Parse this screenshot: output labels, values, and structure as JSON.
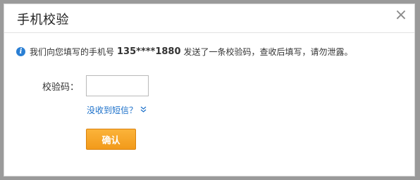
{
  "dialog": {
    "title": "手机校验",
    "close_glyph": "×"
  },
  "notice": {
    "icon": "info-icon",
    "prefix": "我们向您填写的手机号",
    "phone": "135****1880",
    "suffix": "发送了一条校验码，查收后填写，请勿泄露。"
  },
  "form": {
    "code_label": "校验码：",
    "code_value": "",
    "no_sms_link": "没收到短信？",
    "no_sms_icon": "chevron-down-icon",
    "confirm_label": "确认"
  },
  "colors": {
    "accent": "#f5a623",
    "link": "#1a6fc9",
    "info": "#2a7fd4"
  }
}
